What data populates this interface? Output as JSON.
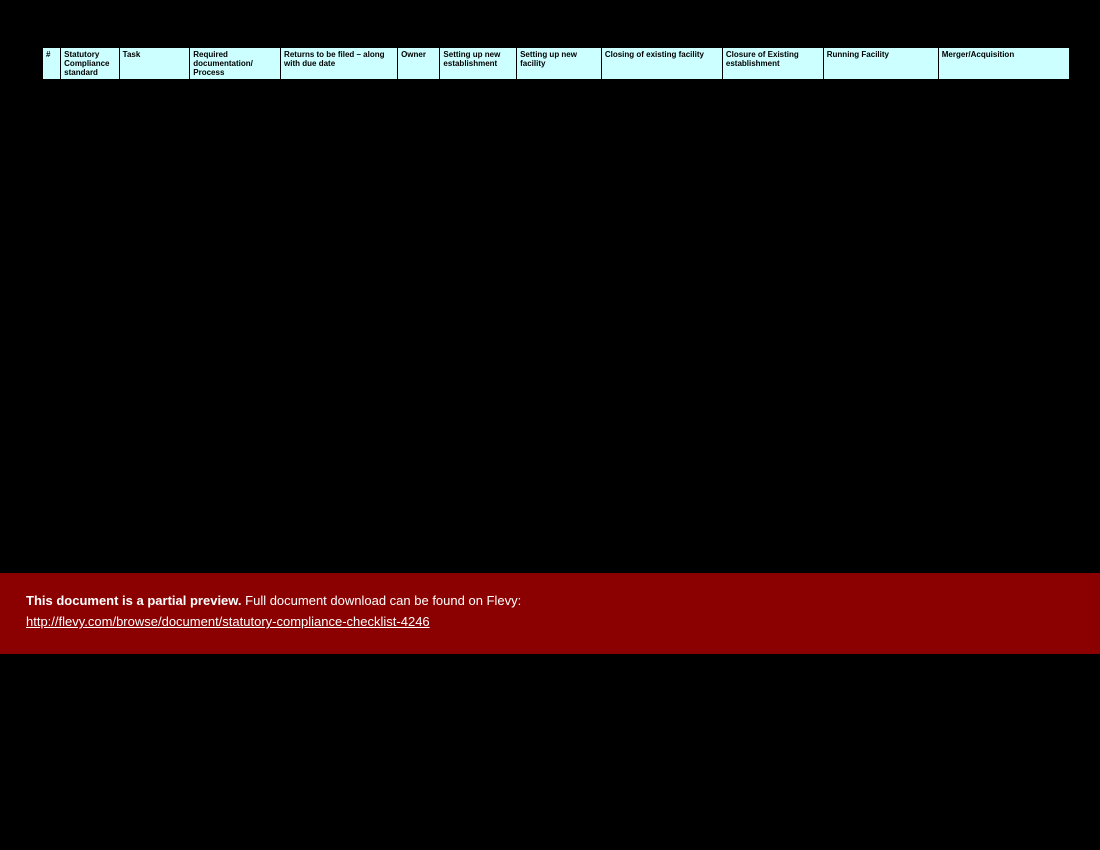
{
  "table": {
    "headers": [
      "#",
      "Statutory Compliance standard",
      "Task",
      "Required documentation/ Process",
      "Returns to be filed – along with due date",
      "Owner",
      "Setting up new establishment",
      "Setting up new facility",
      "Closing of existing facility",
      "Closure of Existing establishment",
      "Running Facility",
      "Merger/Acquisition"
    ]
  },
  "banner": {
    "bold_text": "This document is a partial preview.",
    "remainder_text": "  Full document download can be found on Flevy:",
    "link_text": "http://flevy.com/browse/document/statutory-compliance-checklist-4246"
  }
}
